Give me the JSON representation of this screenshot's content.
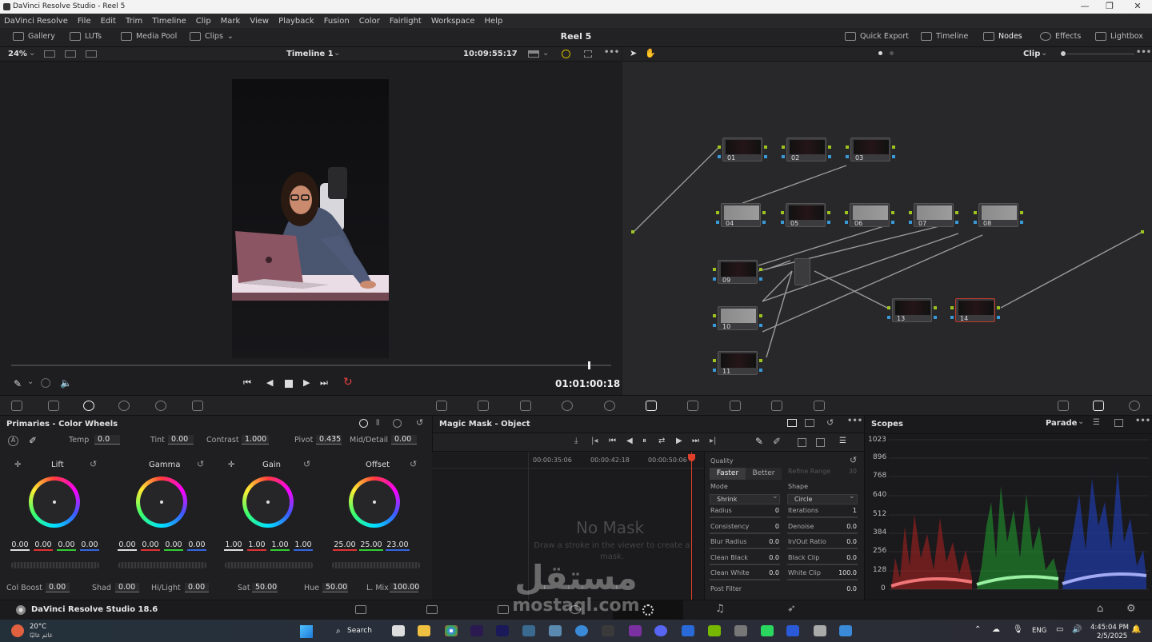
{
  "window": {
    "title": "DaVinci Resolve Studio - Reel 5"
  },
  "menu": [
    "DaVinci Resolve",
    "File",
    "Edit",
    "Trim",
    "Timeline",
    "Clip",
    "Mark",
    "View",
    "Playback",
    "Fusion",
    "Color",
    "Fairlight",
    "Workspace",
    "Help"
  ],
  "toolbar": {
    "left": [
      "Gallery",
      "LUTs",
      "Media Pool",
      "Clips"
    ],
    "title": "Reel 5",
    "right": [
      "Quick Export",
      "Timeline",
      "Nodes",
      "Effects",
      "Lightbox"
    ]
  },
  "viewer": {
    "zoom": "24%",
    "timeline_name": "Timeline 1",
    "timecode_top": "10:09:55:17",
    "timecode": "01:01:00:18"
  },
  "nodes_header": {
    "mode": "Clip"
  },
  "nodes": [
    {
      "label": "01"
    },
    {
      "label": "02"
    },
    {
      "label": "03"
    },
    {
      "label": "04"
    },
    {
      "label": "05"
    },
    {
      "label": "06"
    },
    {
      "label": "07"
    },
    {
      "label": "08"
    },
    {
      "label": "09"
    },
    {
      "label": "10"
    },
    {
      "label": "11"
    },
    {
      "label": "13"
    },
    {
      "label": "14"
    }
  ],
  "primaries": {
    "title": "Primaries - Color Wheels",
    "temp_label": "Temp",
    "temp": "0.0",
    "tint_label": "Tint",
    "tint": "0.00",
    "contrast_label": "Contrast",
    "contrast": "1.000",
    "pivot_label": "Pivot",
    "pivot": "0.435",
    "md_label": "Mid/Detail",
    "md": "0.00",
    "wheels": [
      {
        "name": "Lift",
        "values": [
          "0.00",
          "0.00",
          "0.00",
          "0.00"
        ]
      },
      {
        "name": "Gamma",
        "values": [
          "0.00",
          "0.00",
          "0.00",
          "0.00"
        ]
      },
      {
        "name": "Gain",
        "values": [
          "1.00",
          "1.00",
          "1.00",
          "1.00"
        ]
      },
      {
        "name": "Offset",
        "values": [
          "25.00",
          "25.00",
          "23.00"
        ]
      }
    ],
    "colboost_label": "Col Boost",
    "colboost": "0.00",
    "shad_label": "Shad",
    "shad": "0.00",
    "hilight_label": "Hi/Light",
    "hilight": "0.00",
    "sat_label": "Sat",
    "sat": "50.00",
    "hue_label": "Hue",
    "hue": "50.00",
    "lmix_label": "L. Mix",
    "lmix": "100.00"
  },
  "magic_mask": {
    "title": "Magic Mask - Object",
    "timestamps": [
      "00:00:35:06",
      "00:00:42:18",
      "00:00:50:06"
    ],
    "empty_title": "No Mask",
    "empty_hint": "Draw a stroke in the viewer to create a mask.",
    "quality_label": "Quality",
    "quality_options": [
      "Faster",
      "Better"
    ],
    "refine_label": "Refine Range",
    "refine_val": "30",
    "mode_label": "Mode",
    "mode": "Shrink",
    "shape_label": "Shape",
    "shape": "Circle",
    "params_left": [
      {
        "label": "Radius",
        "value": "0"
      },
      {
        "label": "Consistency",
        "value": "0"
      },
      {
        "label": "Blur Radius",
        "value": "0.0"
      },
      {
        "label": "Clean Black",
        "value": "0.0"
      },
      {
        "label": "Clean White",
        "value": "0.0"
      },
      {
        "label": "Post Filter",
        "value": ""
      }
    ],
    "params_right": [
      {
        "label": "Iterations",
        "value": "1"
      },
      {
        "label": "Denoise",
        "value": "0.0"
      },
      {
        "label": "In/Out Ratio",
        "value": "0.0"
      },
      {
        "label": "Black Clip",
        "value": "0.0"
      },
      {
        "label": "White Clip",
        "value": "100.0"
      },
      {
        "label": "",
        "value": "0.0"
      }
    ]
  },
  "scopes": {
    "title": "Scopes",
    "mode": "Parade",
    "axis": [
      "1023",
      "896",
      "768",
      "640",
      "512",
      "384",
      "256",
      "128",
      "0"
    ]
  },
  "pagebar": {
    "app": "DaVinci Resolve Studio 18.6"
  },
  "taskbar": {
    "weather": "20°C",
    "weather_desc": "غائم غالبًا",
    "search": "Search",
    "lang": "ENG",
    "time": "4:45:04 PM",
    "date": "2/5/2025"
  },
  "watermark": {
    "arabic": "مستقل",
    "latin": "mostaql.com"
  }
}
